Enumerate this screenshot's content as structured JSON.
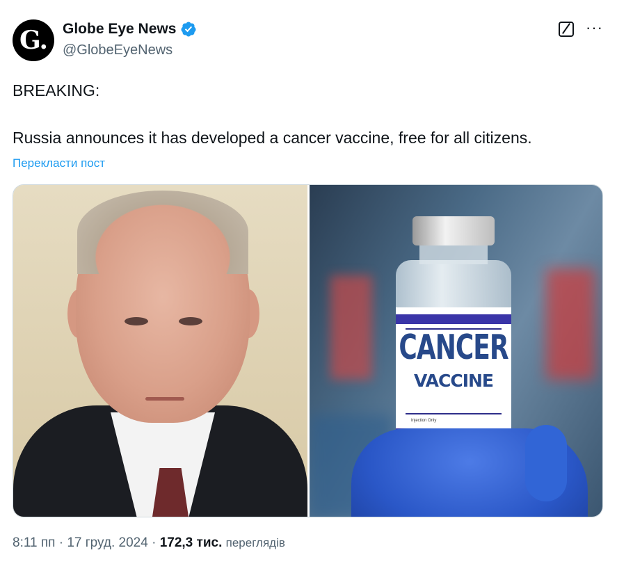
{
  "author": {
    "display_name": "Globe Eye News",
    "handle": "@GlobeEyeNews",
    "avatar_text": "G.",
    "verified": true
  },
  "tweet": {
    "line1": "BREAKING:",
    "line2": "Russia announces it has developed a cancer vaccine, free for all citizens.",
    "translate_label": "Перекласти пост"
  },
  "media": {
    "vial_label_word1": "CANCER",
    "vial_label_word2": "VACCINE",
    "vial_label_small": "Injection Only"
  },
  "meta": {
    "time": "8:11 пп",
    "separator": " · ",
    "date": "17 груд. 2024",
    "views_count": "172,3 тис.",
    "views_label": "переглядів"
  },
  "icons": {
    "verified_color": "#1d9bf0",
    "more": "more-icon",
    "grok": "grok-icon"
  },
  "colors": {
    "link": "#1d9bf0",
    "secondary_text": "#536471",
    "primary_text": "#0f1419"
  }
}
